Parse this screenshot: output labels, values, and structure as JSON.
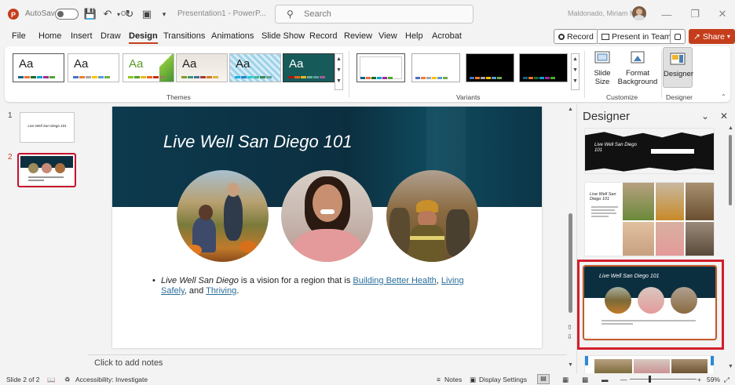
{
  "titlebar": {
    "autosave_label": "AutoSave",
    "autosave_state": "Off",
    "doc_title": "Presentation1 - PowerP...",
    "search_placeholder": "Search",
    "user_name": "Maldonado, Miriam M"
  },
  "menu": {
    "items": [
      "File",
      "Home",
      "Insert",
      "Draw",
      "Design",
      "Transitions",
      "Animations",
      "Slide Show",
      "Record",
      "Review",
      "View",
      "Help",
      "Acrobat"
    ],
    "active": "Design",
    "record_btn": "Record",
    "present_btn": "Present in Teams",
    "share_btn": "Share"
  },
  "ribbon": {
    "themes_label": "Themes",
    "variants_label": "Variants",
    "customize_label": "Customize",
    "designer_group_label": "Designer",
    "theme_aa": "Aa",
    "slide_size": "Slide Size",
    "format_background": "Format Background",
    "designer_btn": "Designer"
  },
  "slides_pane": {
    "slide1_num": "1",
    "slide2_num": "2",
    "slide1_title": "Live Well San Diego 101"
  },
  "slide": {
    "title": "Live Well San Diego 101",
    "bullet_em": "Live Well San Diego",
    "bullet_text1": " is a vision for a region that is ",
    "link1": "Building Better Health",
    "sep1": ", ",
    "link2": "Living Safely",
    "sep2": ", and ",
    "link3": "Thriving",
    "end": "."
  },
  "notes_placeholder": "Click to add notes",
  "designer": {
    "title": "Designer",
    "card1_title": "Live Well San Diego 101",
    "card2_title": "Live Well San Diego 101",
    "card3_title": "Live Well San Diego 101"
  },
  "statusbar": {
    "slide_info": "Slide 2 of 2",
    "accessibility": "Accessibility: Investigate",
    "notes": "Notes",
    "display_settings": "Display Settings",
    "zoom": "59%"
  },
  "colors": {
    "accent": "#c43e1c",
    "selection": "#c8102e",
    "banner": "#0c2f40"
  }
}
